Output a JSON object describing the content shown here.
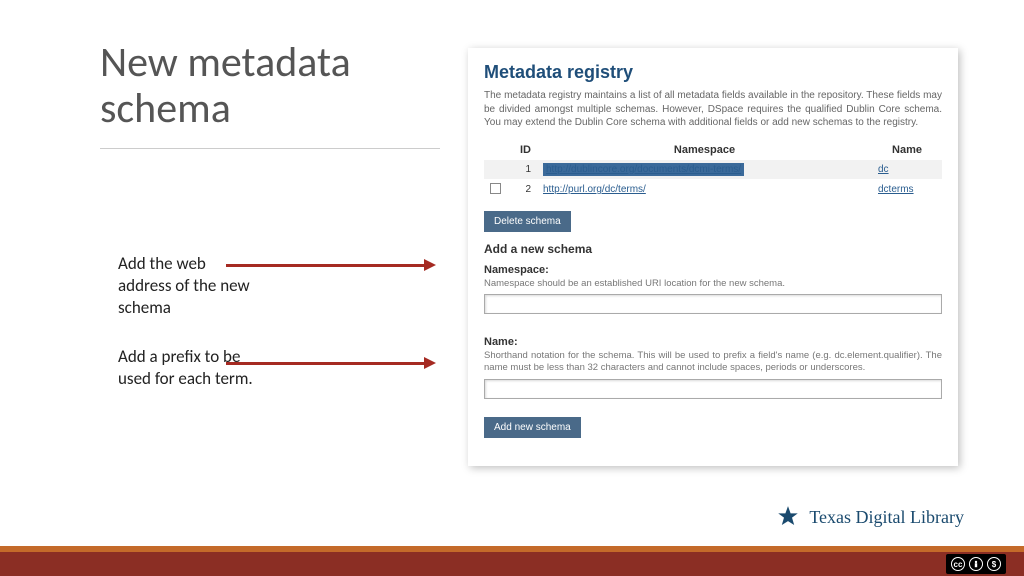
{
  "slide": {
    "title": "New metadata schema",
    "note1": "Add the web address of the new schema",
    "note2": "Add a prefix to be used for each term."
  },
  "panel": {
    "heading": "Metadata registry",
    "intro": "The metadata registry maintains a list of all metadata fields available in the repository. These fields may be divided amongst multiple schemas. However, DSpace requires the qualified Dublin Core schema. You may extend the Dublin Core schema with additional fields or add new schemas to the registry.",
    "columns": {
      "id": "ID",
      "namespace": "Namespace",
      "name": "Name"
    },
    "rows": [
      {
        "id": "1",
        "namespace": "http://dublincore.org/documents/dcmi-terms/",
        "name": "dc",
        "selected": true
      },
      {
        "id": "2",
        "namespace": "http://purl.org/dc/terms/",
        "name": "dcterms",
        "selected": false
      }
    ],
    "delete_btn": "Delete schema",
    "add_heading": "Add a new schema",
    "ns_label": "Namespace:",
    "ns_help": "Namespace should be an established URI location for the new schema.",
    "name_label": "Name:",
    "name_help": "Shorthand notation for the schema. This will be used to prefix a field's name (e.g. dc.element.qualifier). The name must be less than 32 characters and cannot include spaces, periods or underscores.",
    "add_btn": "Add new schema"
  },
  "footer": {
    "brand": "Texas Digital Library",
    "cc": {
      "by": "BY",
      "nc": "NC"
    }
  }
}
